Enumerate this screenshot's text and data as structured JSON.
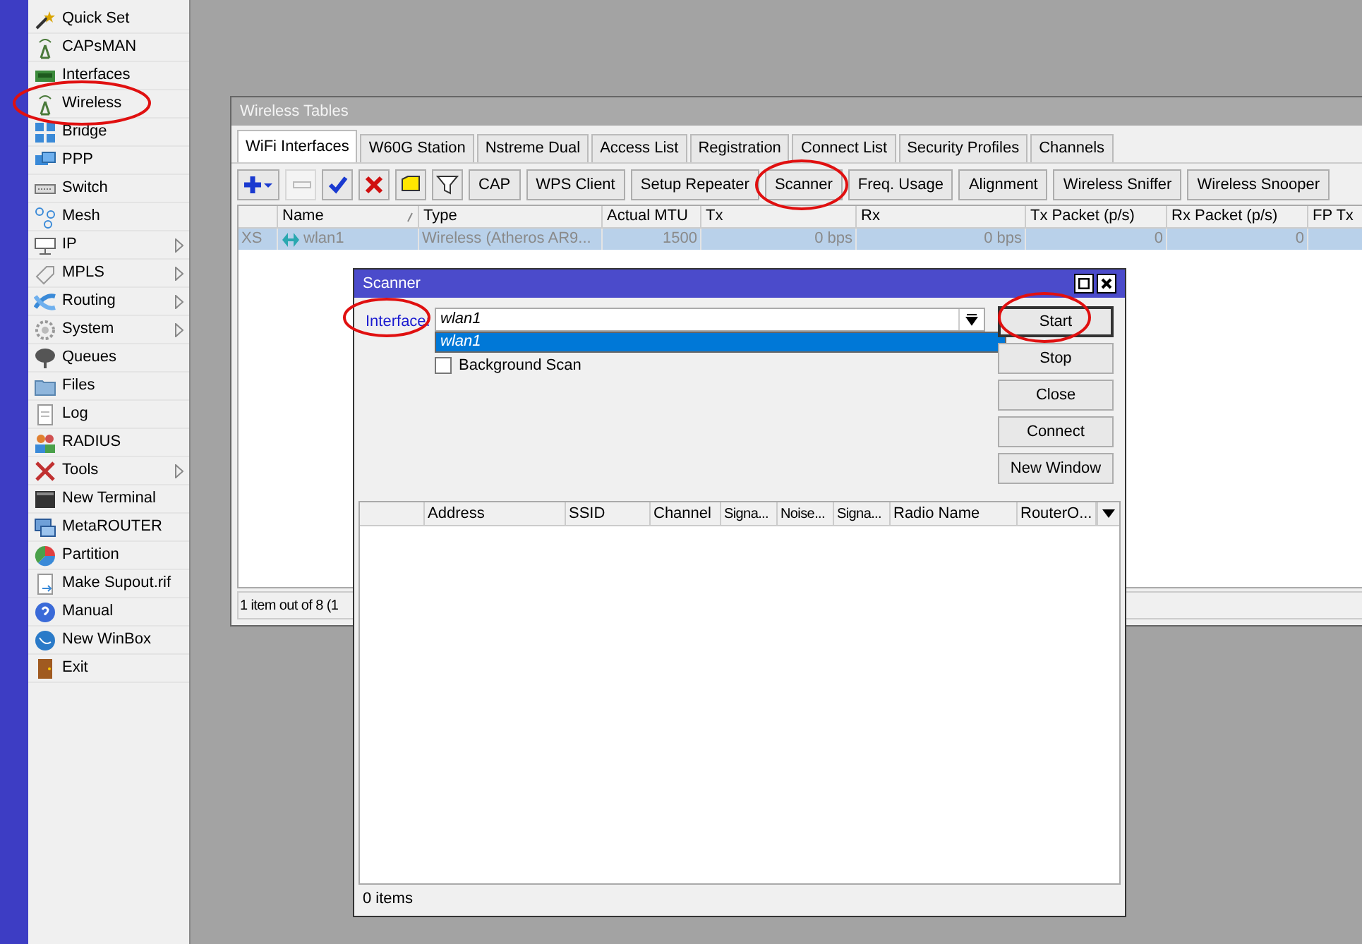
{
  "sidebar": {
    "items": [
      {
        "label": "Quick Set",
        "submenu": false
      },
      {
        "label": "CAPsMAN",
        "submenu": false
      },
      {
        "label": "Interfaces",
        "submenu": false
      },
      {
        "label": "Wireless",
        "submenu": false
      },
      {
        "label": "Bridge",
        "submenu": false
      },
      {
        "label": "PPP",
        "submenu": false
      },
      {
        "label": "Switch",
        "submenu": false
      },
      {
        "label": "Mesh",
        "submenu": false
      },
      {
        "label": "IP",
        "submenu": true
      },
      {
        "label": "MPLS",
        "submenu": true
      },
      {
        "label": "Routing",
        "submenu": true
      },
      {
        "label": "System",
        "submenu": true
      },
      {
        "label": "Queues",
        "submenu": false
      },
      {
        "label": "Files",
        "submenu": false
      },
      {
        "label": "Log",
        "submenu": false
      },
      {
        "label": "RADIUS",
        "submenu": false
      },
      {
        "label": "Tools",
        "submenu": true
      },
      {
        "label": "New Terminal",
        "submenu": false
      },
      {
        "label": "MetaROUTER",
        "submenu": false
      },
      {
        "label": "Partition",
        "submenu": false
      },
      {
        "label": "Make Supout.rif",
        "submenu": false
      },
      {
        "label": "Manual",
        "submenu": false
      },
      {
        "label": "New WinBox",
        "submenu": false
      },
      {
        "label": "Exit",
        "submenu": false
      }
    ]
  },
  "wireless_tables": {
    "title": "Wireless Tables",
    "active": false,
    "tabs": [
      {
        "label": "WiFi Interfaces",
        "selected": true
      },
      {
        "label": "W60G Station",
        "selected": false
      },
      {
        "label": "Nstreme Dual",
        "selected": false
      },
      {
        "label": "Access List",
        "selected": false
      },
      {
        "label": "Registration",
        "selected": false
      },
      {
        "label": "Connect List",
        "selected": false
      },
      {
        "label": "Security Profiles",
        "selected": false
      },
      {
        "label": "Channels",
        "selected": false
      }
    ],
    "icon_buttons": [
      {
        "kind": "add",
        "disabled": false
      },
      {
        "kind": "remove",
        "disabled": true
      },
      {
        "kind": "enable",
        "disabled": false
      },
      {
        "kind": "disable",
        "disabled": false
      },
      {
        "kind": "comment",
        "disabled": false
      },
      {
        "kind": "filter",
        "disabled": false
      }
    ],
    "buttons": [
      "CAP",
      "WPS Client",
      "Setup Repeater",
      "Scanner",
      "Freq. Usage",
      "Alignment",
      "Wireless Sniffer",
      "Wireless Snooper"
    ],
    "table": {
      "columns": [
        "",
        "Name",
        "Type",
        "Actual MTU",
        "Tx",
        "Rx",
        "Tx Packet (p/s)",
        "Rx Packet (p/s)",
        "FP Tx"
      ],
      "rows": [
        {
          "selected": true,
          "disabled": true,
          "cells": [
            "XS",
            "wlan1",
            "Wireless (Atheros AR9...",
            "1500",
            "0 bps",
            "0 bps",
            "0",
            "0",
            ""
          ]
        }
      ]
    },
    "status": "1 item out of 8 (1"
  },
  "scanner": {
    "title": "Scanner",
    "active": true,
    "interface_label": "Interface:",
    "interface_value": "wlan1",
    "dropdown_options": [
      {
        "label": "wlan1",
        "selected": true
      }
    ],
    "background_scan": {
      "label": "Background Scan",
      "checked": false
    },
    "buttons": [
      {
        "label": "Start",
        "default": true
      },
      {
        "label": "Stop",
        "default": false
      },
      {
        "label": "Close",
        "default": false
      },
      {
        "label": "Connect",
        "default": false
      },
      {
        "label": "New Window",
        "default": false
      }
    ],
    "columns": [
      "",
      "Address",
      "SSID",
      "Channel",
      "Signa...",
      "Noise...",
      "Signa...",
      "Radio Name",
      "RouterO..."
    ],
    "status": "0 items"
  }
}
